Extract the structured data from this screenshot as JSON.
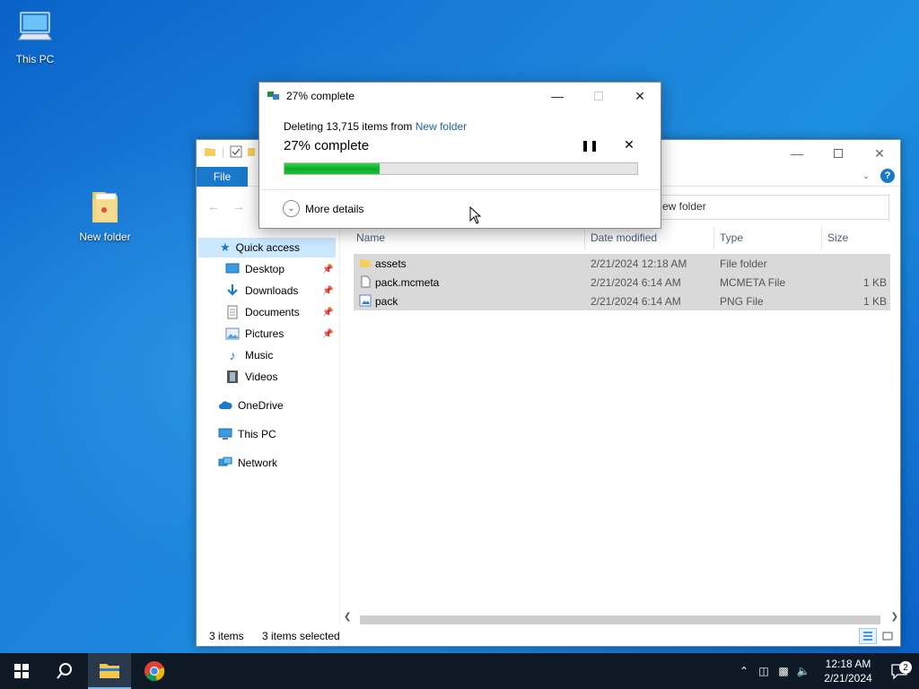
{
  "desktop": {
    "icons": [
      {
        "label": "This PC"
      },
      {
        "label": "New folder"
      }
    ]
  },
  "explorer": {
    "ribbon": {
      "file_tab": "File"
    },
    "search_text": "ew folder",
    "nav": {
      "quick_access": "Quick access",
      "items": [
        "Desktop",
        "Downloads",
        "Documents",
        "Pictures",
        "Music",
        "Videos"
      ],
      "onedrive": "OneDrive",
      "this_pc": "This PC",
      "network": "Network"
    },
    "columns": {
      "name": "Name",
      "date": "Date modified",
      "type": "Type",
      "size": "Size"
    },
    "files": [
      {
        "name": "assets",
        "date": "2/21/2024 12:18 AM",
        "type": "File folder",
        "size": ""
      },
      {
        "name": "pack.mcmeta",
        "date": "2/21/2024 6:14 AM",
        "type": "MCMETA File",
        "size": "1 KB"
      },
      {
        "name": "pack",
        "date": "2/21/2024 6:14 AM",
        "type": "PNG File",
        "size": "1 KB"
      }
    ],
    "status": {
      "items": "3 items",
      "selected": "3 items selected"
    }
  },
  "dialog": {
    "title": "27% complete",
    "deleting_prefix": "Deleting 13,715 items from",
    "deleting_folder": "New folder",
    "big_percent": "27% complete",
    "progress_fraction": 0.27,
    "more_details": "More details",
    "progress_color": "#06b025"
  },
  "taskbar": {
    "time": "12:18 AM",
    "date": "2/21/2024",
    "notification_count": "2"
  }
}
